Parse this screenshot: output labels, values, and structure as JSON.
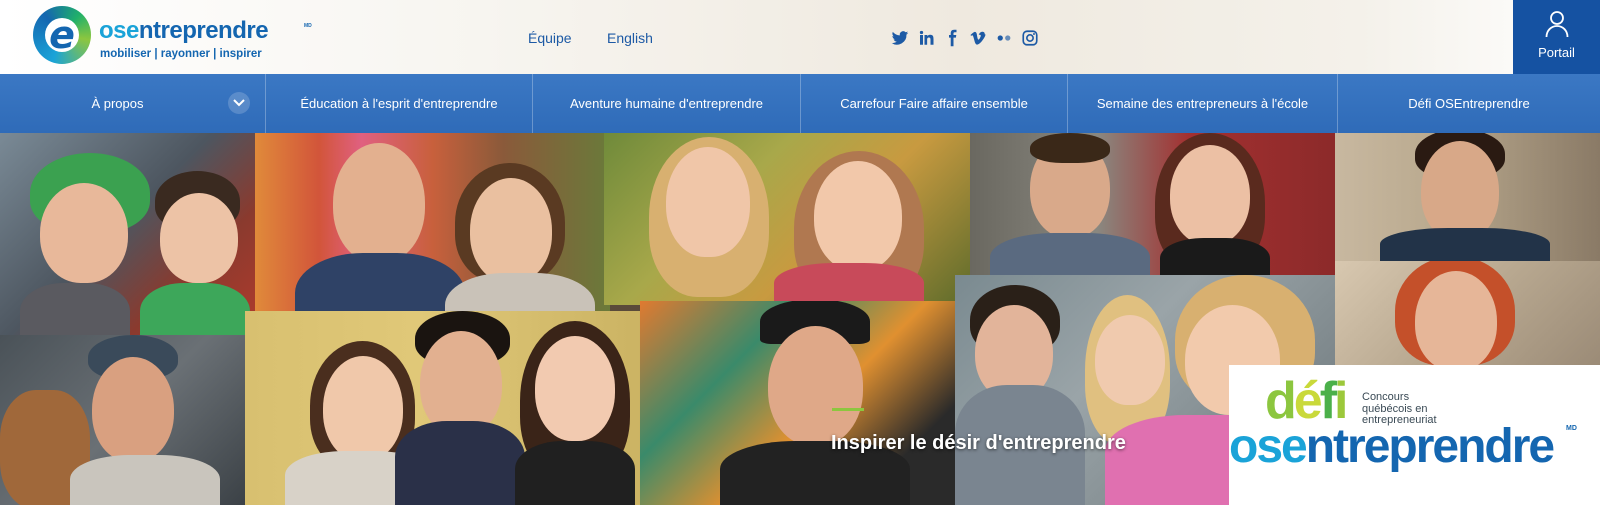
{
  "header": {
    "logo": {
      "word_ose": "ose",
      "word_entreprendre": "ntreprendre",
      "md": "MD",
      "tagline": "mobiliser | rayonner | inspirer"
    },
    "links": {
      "equipe": "Équipe",
      "english": "English"
    },
    "social": [
      "twitter-icon",
      "linkedin-icon",
      "facebook-icon",
      "vimeo-icon",
      "flickr-icon",
      "instagram-icon"
    ],
    "portal_label": "Portail"
  },
  "nav": {
    "items": [
      "À propos",
      "Éducation à l'esprit d'entreprendre",
      "Aventure humaine d'entreprendre",
      "Carrefour Faire affaire ensemble",
      "Semaine des entrepreneurs à l'école",
      "Défi OSEntreprendre"
    ]
  },
  "hero": {
    "slogan": "Inspirer le désir d'entreprendre",
    "defi_badge": {
      "word_d": "d",
      "word_e": "é",
      "word_f": "f",
      "word_i": "i",
      "subtitle_1": "Concours",
      "subtitle_2": "québécois en",
      "subtitle_3": "entrepreneuriat",
      "word_ose": "ose",
      "word_entreprendre": "ntreprendre",
      "md": "MD"
    }
  },
  "colors": {
    "brand_blue": "#1466b0",
    "brand_cyan": "#1aa3d8",
    "brand_green": "#8cc63f",
    "nav_bg": "#2f6bb8",
    "portal_bg": "#1552a2"
  }
}
